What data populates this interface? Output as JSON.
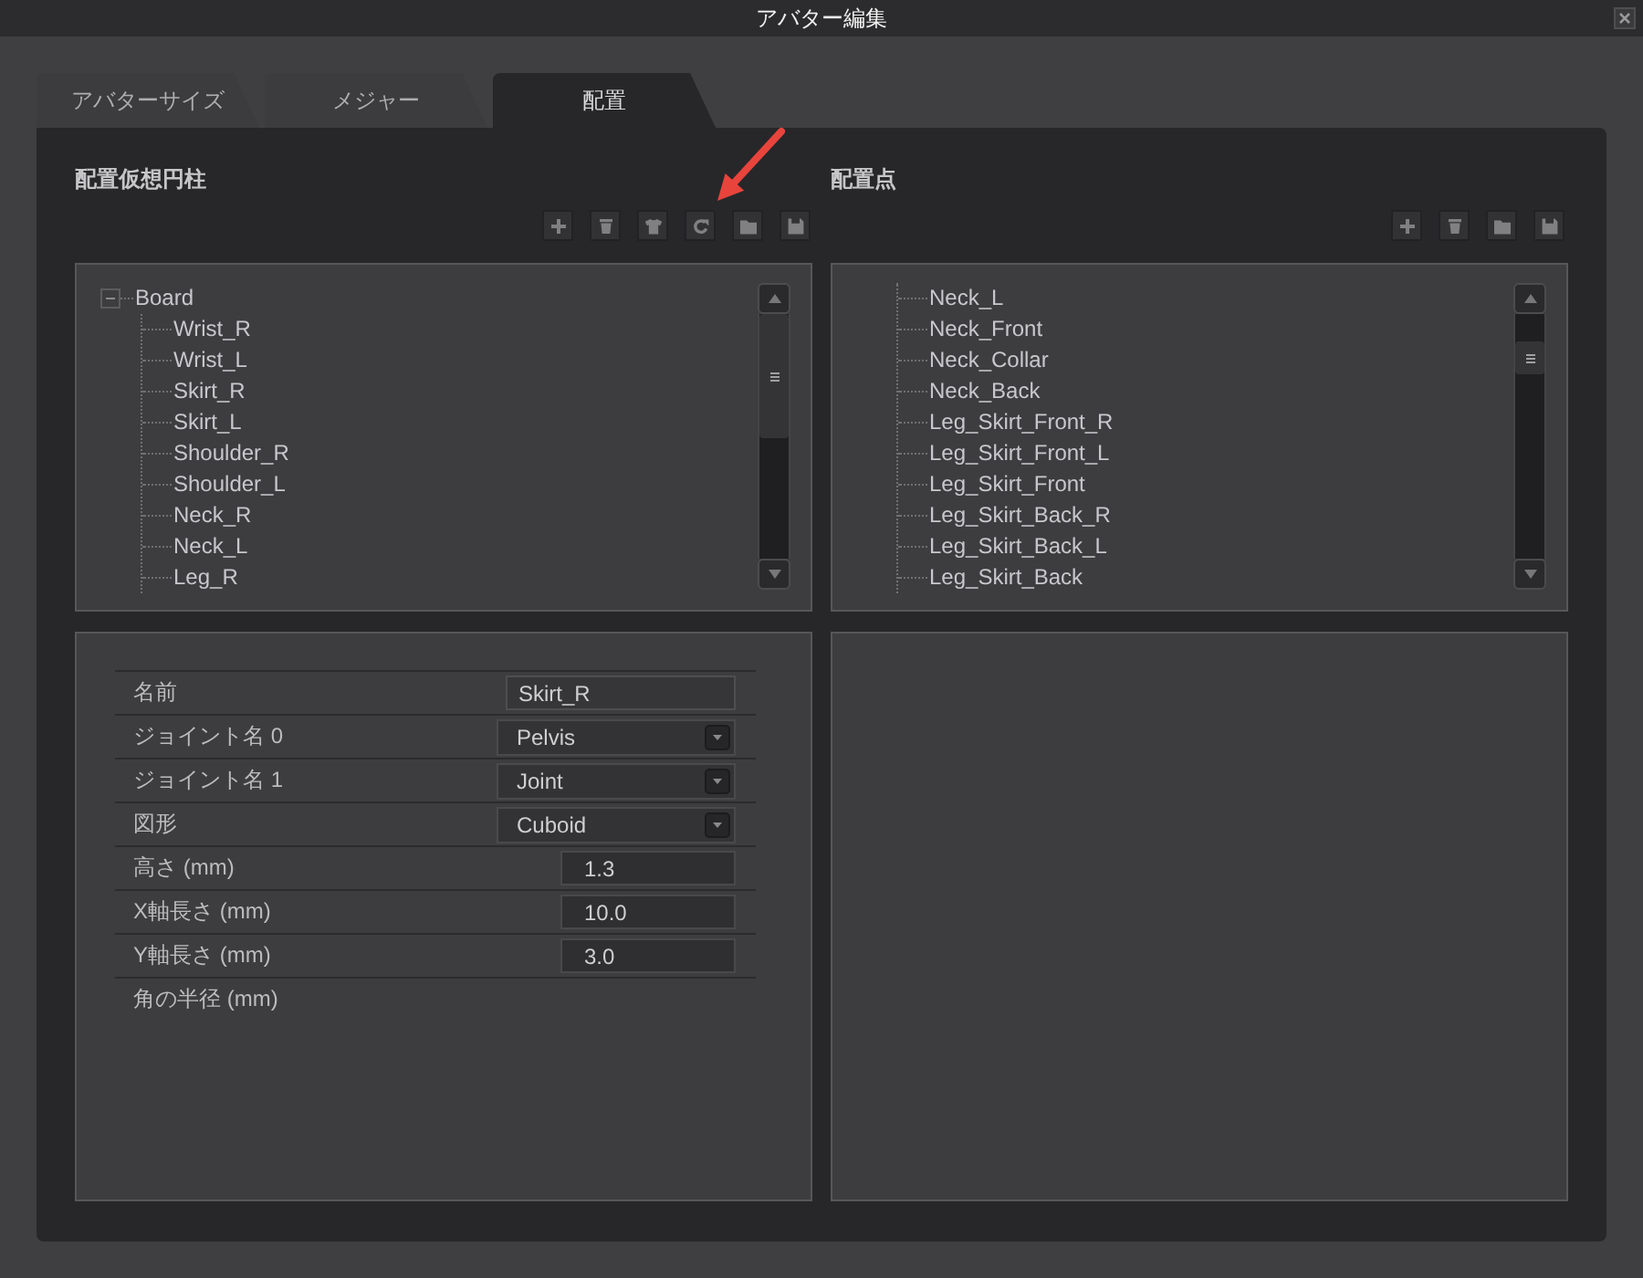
{
  "window": {
    "title": "アバター編集"
  },
  "tabs": [
    {
      "label": "アバターサイズ",
      "selected": false
    },
    {
      "label": "メジャー",
      "selected": false
    },
    {
      "label": "配置",
      "selected": true
    }
  ],
  "left_panel": {
    "title": "配置仮想円柱",
    "tree": {
      "label": "Board",
      "expanded": true,
      "children": [
        {
          "label": "Wrist_R"
        },
        {
          "label": "Wrist_L"
        },
        {
          "label": "Skirt_R"
        },
        {
          "label": "Skirt_L"
        },
        {
          "label": "Shoulder_R"
        },
        {
          "label": "Shoulder_L"
        },
        {
          "label": "Neck_R"
        },
        {
          "label": "Neck_L"
        },
        {
          "label": "Leg_R"
        }
      ]
    }
  },
  "right_panel": {
    "title": "配置点",
    "tree": {
      "children": [
        {
          "label": "Neck_L"
        },
        {
          "label": "Neck_Front"
        },
        {
          "label": "Neck_Collar"
        },
        {
          "label": "Neck_Back"
        },
        {
          "label": "Leg_Skirt_Front_R"
        },
        {
          "label": "Leg_Skirt_Front_L"
        },
        {
          "label": "Leg_Skirt_Front"
        },
        {
          "label": "Leg_Skirt_Back_R"
        },
        {
          "label": "Leg_Skirt_Back_L"
        },
        {
          "label": "Leg_Skirt_Back"
        }
      ]
    }
  },
  "properties": [
    {
      "label": "名前",
      "kind": "text",
      "value": "Skirt_R"
    },
    {
      "label": "ジョイント名 0",
      "kind": "dropdown",
      "value": "Pelvis"
    },
    {
      "label": "ジョイント名 1",
      "kind": "dropdown",
      "value": "Joint"
    },
    {
      "label": "図形",
      "kind": "dropdown",
      "value": "Cuboid"
    },
    {
      "label": "高さ (mm)",
      "kind": "number",
      "value": "1.3"
    },
    {
      "label": "X軸長さ (mm)",
      "kind": "number",
      "value": "10.0"
    },
    {
      "label": "Y軸長さ (mm)",
      "kind": "number",
      "value": "3.0"
    },
    {
      "label": "角の半径 (mm)",
      "kind": "label"
    }
  ]
}
